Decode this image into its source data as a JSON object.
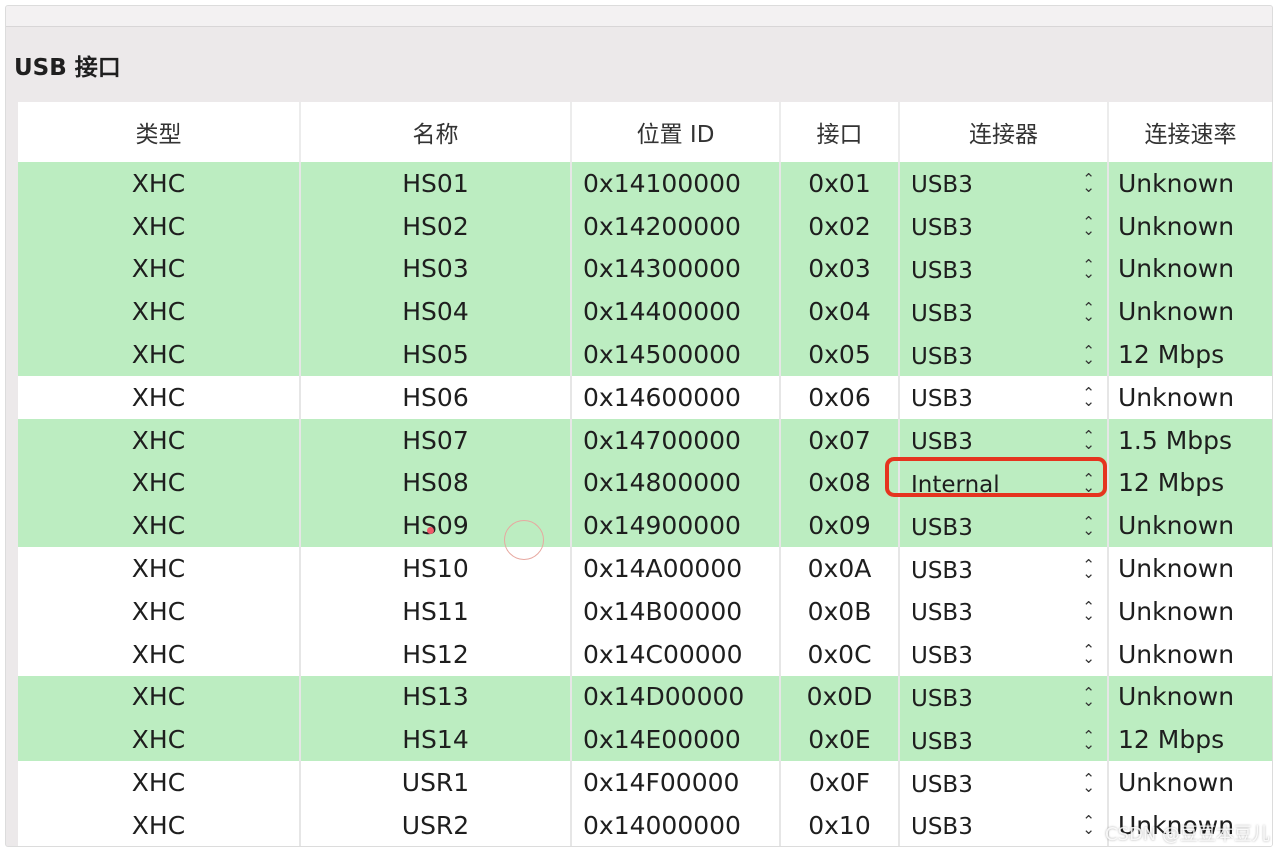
{
  "section": {
    "title": "USB 接口"
  },
  "table": {
    "headers": {
      "type": "类型",
      "name": "名称",
      "location": "位置 ID",
      "port": "接口",
      "connector": "连接器",
      "speed": "连接速率"
    },
    "rows": [
      {
        "type": "XHC",
        "name": "HS01",
        "location": "0x14100000",
        "port": "0x01",
        "connector": "USB3",
        "speed": "Unknown",
        "highlighted": true
      },
      {
        "type": "XHC",
        "name": "HS02",
        "location": "0x14200000",
        "port": "0x02",
        "connector": "USB3",
        "speed": "Unknown",
        "highlighted": true
      },
      {
        "type": "XHC",
        "name": "HS03",
        "location": "0x14300000",
        "port": "0x03",
        "connector": "USB3",
        "speed": "Unknown",
        "highlighted": true
      },
      {
        "type": "XHC",
        "name": "HS04",
        "location": "0x14400000",
        "port": "0x04",
        "connector": "USB3",
        "speed": "Unknown",
        "highlighted": true
      },
      {
        "type": "XHC",
        "name": "HS05",
        "location": "0x14500000",
        "port": "0x05",
        "connector": "USB3",
        "speed": "12 Mbps",
        "highlighted": true
      },
      {
        "type": "XHC",
        "name": "HS06",
        "location": "0x14600000",
        "port": "0x06",
        "connector": "USB3",
        "speed": "Unknown",
        "highlighted": false
      },
      {
        "type": "XHC",
        "name": "HS07",
        "location": "0x14700000",
        "port": "0x07",
        "connector": "USB3",
        "speed": "1.5 Mbps",
        "highlighted": true
      },
      {
        "type": "XHC",
        "name": "HS08",
        "location": "0x14800000",
        "port": "0x08",
        "connector": "Internal",
        "speed": "12 Mbps",
        "highlighted": true
      },
      {
        "type": "XHC",
        "name": "HS09",
        "location": "0x14900000",
        "port": "0x09",
        "connector": "USB3",
        "speed": "Unknown",
        "highlighted": true
      },
      {
        "type": "XHC",
        "name": "HS10",
        "location": "0x14A00000",
        "port": "0x0A",
        "connector": "USB3",
        "speed": "Unknown",
        "highlighted": false
      },
      {
        "type": "XHC",
        "name": "HS11",
        "location": "0x14B00000",
        "port": "0x0B",
        "connector": "USB3",
        "speed": "Unknown",
        "highlighted": false
      },
      {
        "type": "XHC",
        "name": "HS12",
        "location": "0x14C00000",
        "port": "0x0C",
        "connector": "USB3",
        "speed": "Unknown",
        "highlighted": false
      },
      {
        "type": "XHC",
        "name": "HS13",
        "location": "0x14D00000",
        "port": "0x0D",
        "connector": "USB3",
        "speed": "Unknown",
        "highlighted": true
      },
      {
        "type": "XHC",
        "name": "HS14",
        "location": "0x14E00000",
        "port": "0x0E",
        "connector": "USB3",
        "speed": "12 Mbps",
        "highlighted": true
      },
      {
        "type": "XHC",
        "name": "USR1",
        "location": "0x14F00000",
        "port": "0x0F",
        "connector": "USB3",
        "speed": "Unknown",
        "highlighted": false
      },
      {
        "type": "XHC",
        "name": "USR2",
        "location": "0x14000000",
        "port": "0x10",
        "connector": "USB3",
        "speed": "Unknown",
        "highlighted": false
      }
    ],
    "annotated_row": 7
  },
  "icons": {
    "connector_stepper": "chevron-up-down-icon"
  },
  "colors": {
    "row_highlight": "#bcedc1",
    "row_plain": "#ffffff",
    "annotation_box": "#e5341f"
  },
  "watermark": "CSDN @豆豆本豆儿"
}
